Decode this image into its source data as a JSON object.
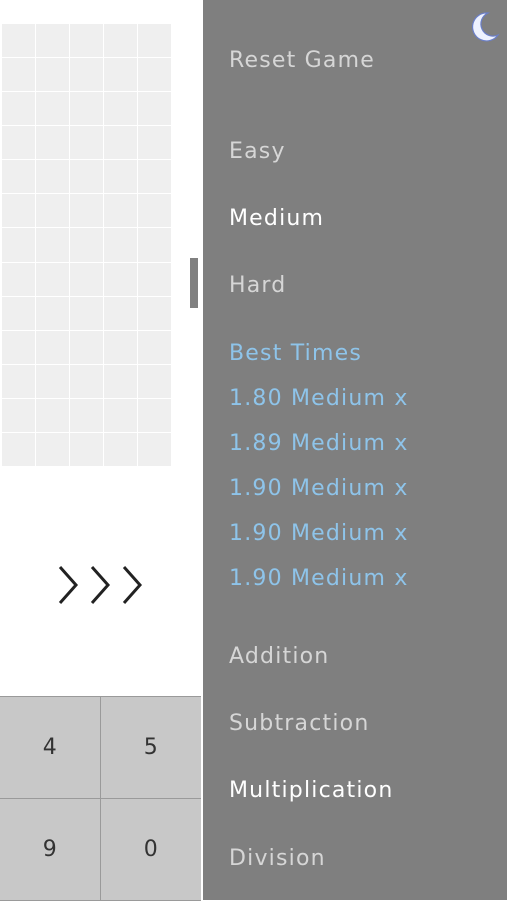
{
  "board": {
    "columns": 5,
    "rows": 13
  },
  "keypad": {
    "keys": [
      "4",
      "5",
      "9",
      "0"
    ]
  },
  "menu": {
    "reset": "Reset Game",
    "difficulty": [
      "Easy",
      "Medium",
      "Hard"
    ],
    "active_difficulty": "Medium",
    "best_times_title": "Best Times",
    "best_times": [
      "1.80 Medium x",
      "1.89 Medium x",
      "1.90 Medium x",
      "1.90 Medium x",
      "1.90 Medium x"
    ],
    "operations": [
      "Addition",
      "Subtraction",
      "Multiplication",
      "Division"
    ],
    "active_operation": "Multiplication"
  },
  "icons": {
    "theme_toggle": "moon-icon",
    "next": "chevrons-right-icon"
  },
  "colors": {
    "menu_bg": "#7f7f7f",
    "menu_text": "#d6d6d6",
    "menu_active": "#ffffff",
    "best_times": "#8ec4ea",
    "grid": "#efefef",
    "keypad": "#c8c8c8"
  }
}
